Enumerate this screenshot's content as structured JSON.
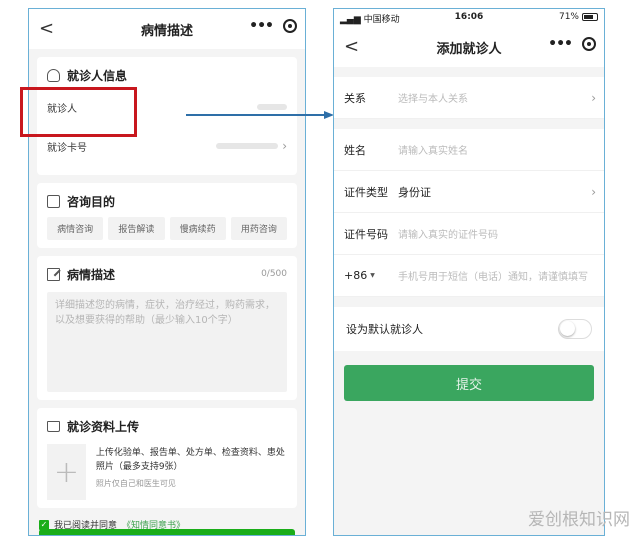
{
  "left": {
    "nav": {
      "back": "<",
      "title": "病情描述"
    },
    "patient_card": {
      "title": "就诊人信息",
      "patient_label": "就诊人",
      "card_label": "就诊卡号"
    },
    "purpose_card": {
      "title": "咨询目的",
      "chips": [
        "病情咨询",
        "报告解读",
        "慢病续药",
        "用药咨询"
      ]
    },
    "desc_card": {
      "title": "病情描述",
      "count": "0/500",
      "placeholder": "详细描述您的病情，症状，治疗经过，购药需求，以及想要获得的帮助（最少输入10个字）"
    },
    "upload_card": {
      "title": "就诊资料上传",
      "plus": "+",
      "text": "上传化验单、报告单、处方单、检查资料、患处照片（最多支持9张）",
      "note": "照片仅自己和医生可见"
    },
    "agree": {
      "check": "✓",
      "prefix": "我已阅读并同意",
      "link": "《知情同意书》"
    }
  },
  "right": {
    "status": {
      "carrier": "中国移动",
      "time": "16:06",
      "battery": "71%"
    },
    "nav": {
      "back": "<",
      "title": "添加就诊人"
    },
    "fields": {
      "relation": {
        "label": "关系",
        "placeholder": "选择与本人关系"
      },
      "name": {
        "label": "姓名",
        "placeholder": "请输入真实姓名"
      },
      "id_type": {
        "label": "证件类型",
        "value": "身份证"
      },
      "id_number": {
        "label": "证件号码",
        "placeholder": "请输入真实的证件号码"
      },
      "phone": {
        "code": "+86",
        "placeholder": "手机号用于短信（电话）通知，请谨慎填写"
      }
    },
    "default_label": "设为默认就诊人",
    "submit_label": "提交"
  },
  "watermark": "爱创根知识网",
  "colors": {
    "highlight": "#c8171e",
    "arrow": "#2e6fa8",
    "submit": "#3aa65f",
    "agree_link": "#3fa14f"
  }
}
